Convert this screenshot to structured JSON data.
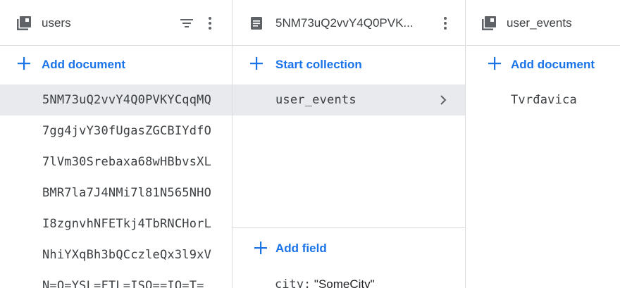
{
  "columns": [
    {
      "title": "users",
      "icon": "collection-icon",
      "add_label": "Add document",
      "items": [
        {
          "label": "5NM73uQ2vvY4Q0PVKYCqqMQ",
          "selected": true
        },
        {
          "label": "7gg4jvY30fUgasZGCBIYdfO"
        },
        {
          "label": "7lVm30Srebaxa68wHBbvsXL"
        },
        {
          "label": "BMR7la7J4NMi7l81N565NHO"
        },
        {
          "label": "I8zgnvhNFETkj4TbRNCHorL"
        },
        {
          "label": "NhiYXqBh3bQCczleQx3l9xV"
        },
        {
          "label": "N=O=YSL=FTL=ISO==IO=T="
        }
      ]
    },
    {
      "title": "5NM73uQ2vvY4Q0PVK...",
      "icon": "document-icon",
      "add_label": "Start collection",
      "items": [
        {
          "label": "user_events",
          "selected": true
        }
      ],
      "add_field_label": "Add field",
      "fields": [
        {
          "key": "city:",
          "value": "\"SomeCity\""
        }
      ]
    },
    {
      "title": "user_events",
      "icon": "collection-icon",
      "add_label": "Add document",
      "items": [
        {
          "label": "Tvrđavica"
        }
      ]
    }
  ],
  "colors": {
    "accent": "#1a73e8",
    "selected_bg": "#e8eaed",
    "divider": "#dadce0"
  }
}
